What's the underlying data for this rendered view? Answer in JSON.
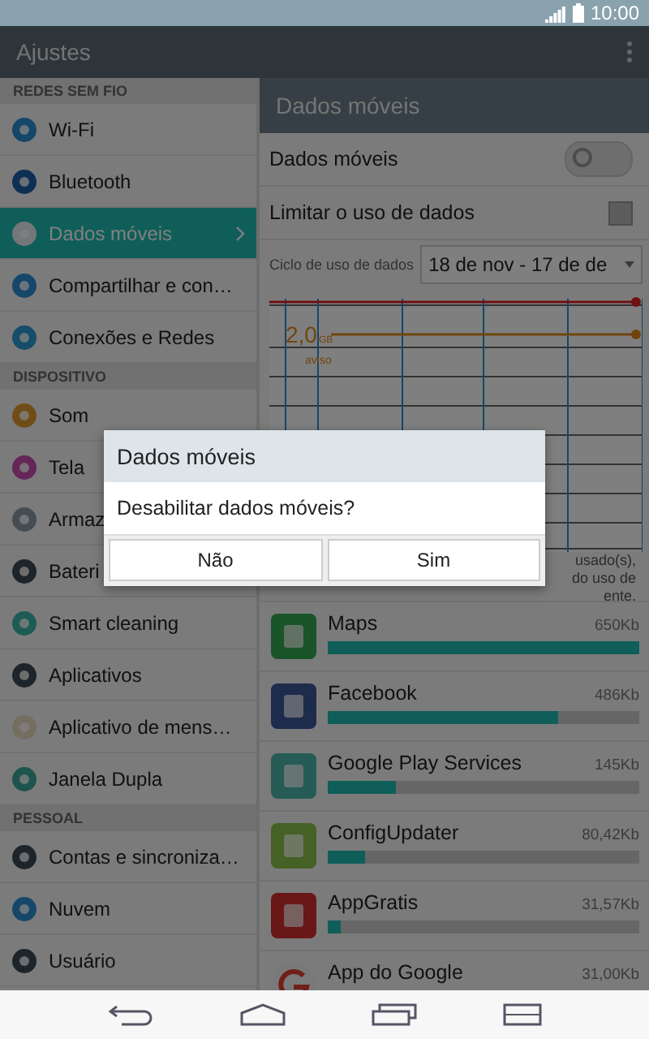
{
  "status_bar": {
    "time": "10:00"
  },
  "app_bar": {
    "title": "Ajustes"
  },
  "sidebar": {
    "sections": [
      {
        "header": "REDES SEM FIO",
        "items": [
          {
            "label": "Wi-Fi",
            "selected": false
          },
          {
            "label": "Bluetooth",
            "selected": false
          },
          {
            "label": "Dados móveis",
            "selected": true
          },
          {
            "label": "Compartilhar e con…",
            "selected": false
          },
          {
            "label": "Conexões e Redes",
            "selected": false
          }
        ]
      },
      {
        "header": "DISPOSITIVO",
        "items": [
          {
            "label": "Som",
            "selected": false
          },
          {
            "label": "Tela",
            "selected": false
          },
          {
            "label": "Armaz",
            "selected": false
          },
          {
            "label": "Bateri",
            "selected": false
          },
          {
            "label": "Smart cleaning",
            "selected": false
          },
          {
            "label": "Aplicativos",
            "selected": false
          },
          {
            "label": "Aplicativo de mens…",
            "selected": false
          },
          {
            "label": "Janela Dupla",
            "selected": false
          }
        ]
      },
      {
        "header": "PESSOAL",
        "items": [
          {
            "label": "Contas e sincroniza…",
            "selected": false
          },
          {
            "label": "Nuvem",
            "selected": false
          },
          {
            "label": "Usuário",
            "selected": false
          }
        ]
      }
    ]
  },
  "detail": {
    "title": "Dados móveis",
    "settings": [
      {
        "kind": "toggle",
        "label": "Dados móveis",
        "on": false
      },
      {
        "kind": "checkbox",
        "label": "Limitar o uso de dados",
        "checked": false
      }
    ],
    "cycle": {
      "label": "Ciclo de uso de dados",
      "value": "18 de nov - 17 de de"
    },
    "chart": {
      "warning_value": "2,0",
      "warning_unit": "GB",
      "warning_label": "aviso"
    },
    "note_lines": [
      "usado(s),",
      "do uso de",
      "ente."
    ],
    "apps": [
      {
        "name": "Maps",
        "usage": "650Kb",
        "level": 1
      },
      {
        "name": "Facebook",
        "usage": "486Kb",
        "level": 0.74
      },
      {
        "name": "Google Play Services",
        "usage": "145Kb",
        "level": 0.22
      },
      {
        "name": "ConfigUpdater",
        "usage": "80,42Kb",
        "level": 0.12
      },
      {
        "name": "AppGratis",
        "usage": "31,57Kb",
        "level": 0.04
      },
      {
        "name": "App do Google",
        "usage": "31,00Kb"
      }
    ]
  },
  "dialog": {
    "title": "Dados móveis",
    "message": "Desabilitar dados móveis?",
    "buttons": [
      "Não",
      "Sim"
    ]
  }
}
